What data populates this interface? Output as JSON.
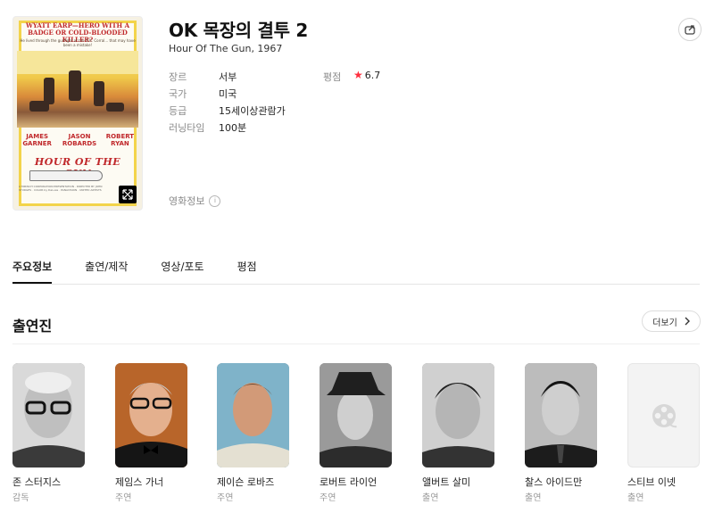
{
  "movie": {
    "title": "OK 목장의 결투 2",
    "subtitle": "Hour Of The Gun, 1967",
    "poster": {
      "tagline": "WYATT EARP—HERO WITH A BADGE OR COLD-BLOODED KILLER?",
      "tagline2": "He lived through the gunfight at the O.K. Corral... that may have been a mistake!",
      "names": [
        "JAMES GARNER",
        "JASON ROBARDS",
        "ROBERT RYAN"
      ],
      "title": "HOUR OF THE GUN",
      "fine_print": "A MIRISCH CORPORATION PRESENTATION · DIRECTED BY JOHN STURGES · COLOR by DeLuxe · PANAVISION · UNITED ARTISTS"
    },
    "info": [
      {
        "label": "장르",
        "value": "서부"
      },
      {
        "label": "국가",
        "value": "미국"
      },
      {
        "label": "등급",
        "value": "15세이상관람가"
      },
      {
        "label": "러닝타임",
        "value": "100분"
      }
    ],
    "rating_label": "평점",
    "rating_value": "6.7",
    "movie_info_label": "영화정보",
    "info_icon": "i"
  },
  "tabs": [
    {
      "label": "주요정보",
      "active": true
    },
    {
      "label": "출연/제작",
      "active": false
    },
    {
      "label": "영상/포토",
      "active": false
    },
    {
      "label": "평점",
      "active": false
    }
  ],
  "cast_section": {
    "title": "출연진",
    "more_label": "더보기",
    "members": [
      {
        "name": "존 스터지스",
        "role": "감독"
      },
      {
        "name": "제임스 가너",
        "role": "주연"
      },
      {
        "name": "제이슨 로바즈",
        "role": "주연"
      },
      {
        "name": "로버트 라이언",
        "role": "주연"
      },
      {
        "name": "앨버트 살미",
        "role": "출연"
      },
      {
        "name": "찰스 아이드만",
        "role": "출연"
      },
      {
        "name": "스티브 이넷",
        "role": "출연"
      }
    ]
  },
  "colors": {
    "rating_star": "#ff2f3e",
    "accent": "#111111"
  }
}
